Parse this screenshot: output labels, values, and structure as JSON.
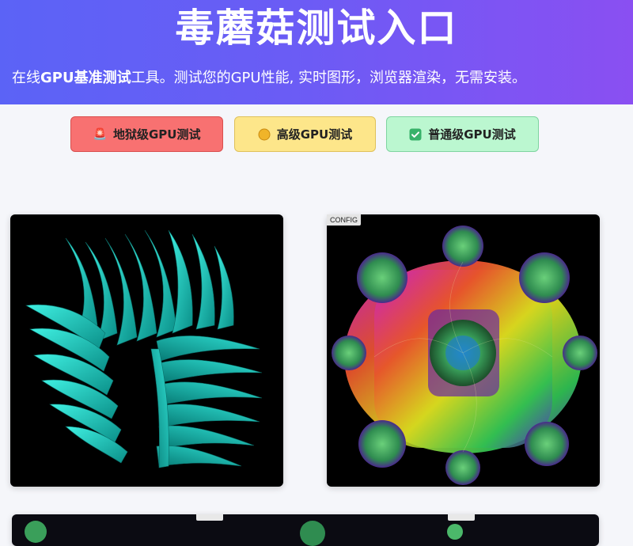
{
  "header": {
    "title": "毒蘑菇测试入口",
    "subtitle_parts": [
      "在线",
      "GPU基准测试",
      "工具。测试您的GPU性能, 实时图形，浏览器渲染，无需安装。"
    ]
  },
  "buttons": [
    {
      "label": "地狱级GPU测试",
      "icon": "siren-icon"
    },
    {
      "label": "高级GPU测试",
      "icon": "orange-circle-icon"
    },
    {
      "label": "普通级GPU测试",
      "icon": "check-box-icon"
    }
  ],
  "canvas_right": {
    "config_label": "CONFIG"
  },
  "colors": {
    "header_gradient_start": "#5b63f6",
    "header_gradient_end": "#8a4ff2",
    "hell_button": "#f87171",
    "high_button": "#fde68a",
    "normal_button": "#bbf7d0",
    "teal_render": "#13c7bd"
  }
}
